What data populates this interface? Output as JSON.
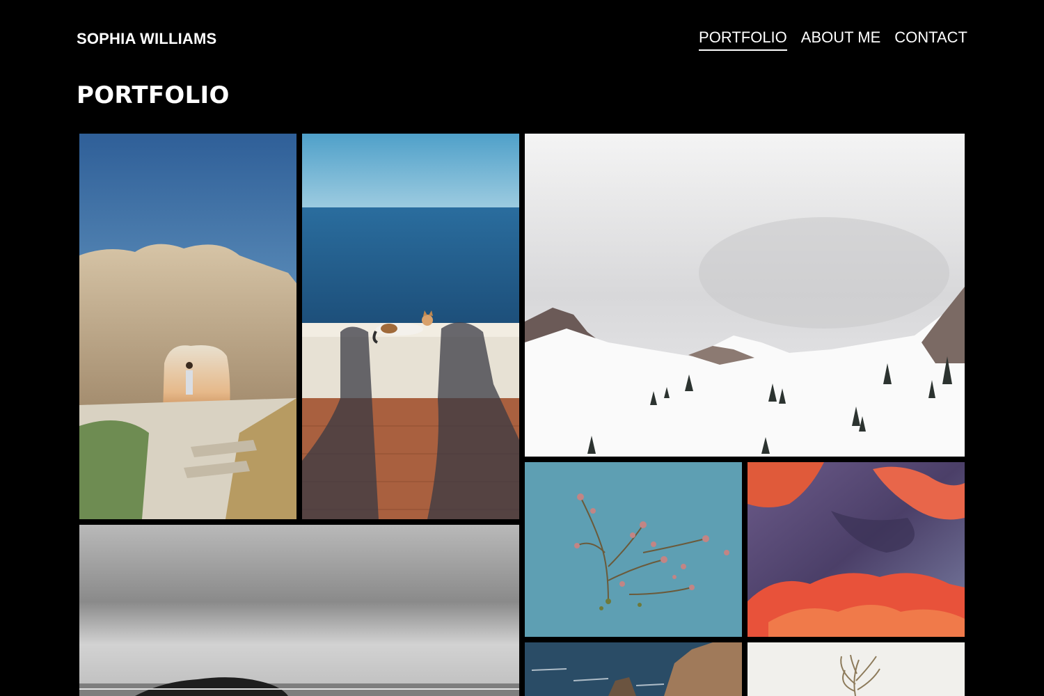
{
  "header": {
    "site_name": "SOPHIA WILLIAMS",
    "nav": [
      {
        "label": "PORTFOLIO",
        "active": true
      },
      {
        "label": "ABOUT ME",
        "active": false
      },
      {
        "label": "CONTACT",
        "active": false
      }
    ]
  },
  "main": {
    "title": "PORTFOLIO"
  },
  "colors": {
    "background": "#000000",
    "text": "#ffffff"
  }
}
